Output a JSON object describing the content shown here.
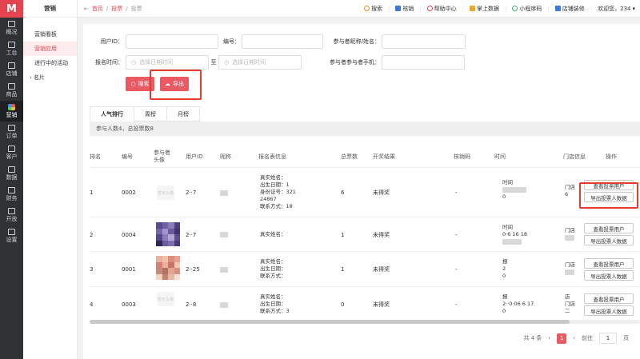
{
  "logo": "M",
  "left_nav": [
    {
      "label": "概况"
    },
    {
      "label": "工台"
    },
    {
      "label": "店铺"
    },
    {
      "label": "商品"
    },
    {
      "label": "营销"
    },
    {
      "label": "订单"
    },
    {
      "label": "客户"
    },
    {
      "label": "数据"
    },
    {
      "label": "财务"
    },
    {
      "label": "开放"
    },
    {
      "label": "设置"
    }
  ],
  "sub_nav": {
    "title": "营销",
    "items": [
      "营销看板",
      "营销应用",
      "进行中的活动"
    ],
    "group": "名片"
  },
  "breadcrumb": {
    "home": "首页",
    "level1": "投票",
    "current": "投票"
  },
  "toolbar": {
    "search": "搜索",
    "verify": "核销",
    "help": "帮助中心",
    "palm_data": "掌上数据",
    "mini_code": "小程序码",
    "decorate": "店铺装修",
    "welcome": "欢迎您，234"
  },
  "filters": {
    "user_id_label": "用户ID：",
    "number_label": "编号：",
    "participant_label": "参与者昵称/姓名：",
    "signup_time_label": "报名时间：",
    "start_placeholder": "选择日期时间",
    "to": "至",
    "end_placeholder": "选择日期时间",
    "phone_label": "参与者参与者手机："
  },
  "buttons": {
    "search": "搜索",
    "export": "导出"
  },
  "tabs": [
    "人气排行",
    "周榜",
    "月榜"
  ],
  "summary": "参与人数4，总投票数8",
  "table": {
    "headers": [
      "排名",
      "编号",
      "参与者头像",
      "用户ID",
      "昵称",
      "报名表信息",
      "总票数",
      "开奖结果",
      "核销码",
      "时间",
      "门店信息",
      "操作"
    ],
    "rows": [
      {
        "rank": "1",
        "number": "0002",
        "avatar_text": "暂无头像",
        "user_id": "2··7",
        "info": [
          "真实姓名：",
          "出生日期：1",
          "身份证号：321",
          "24867",
          "联系方式：18"
        ],
        "votes": "6",
        "result": "未得奖",
        "code": "-",
        "time": [
          "时间",
          "0"
        ],
        "store": [
          "门店",
          "6"
        ],
        "ops": [
          "查看投票用户",
          "导出投票人数据"
        ]
      },
      {
        "rank": "2",
        "number": "0004",
        "avatar_text": "",
        "user_id": "2··7",
        "info": [
          "真实姓名："
        ],
        "votes": "1",
        "result": "未得奖",
        "code": "-",
        "time": [
          "时间",
          "0·6  16 18"
        ],
        "store": [
          "门店",
          ""
        ],
        "ops": [
          "查看投票用户",
          "导出投票人数据"
        ]
      },
      {
        "rank": "3",
        "number": "0001",
        "avatar_text": "",
        "user_id": "2··25",
        "info": [
          "真实姓名：",
          "出生日期：",
          "联系方式："
        ],
        "votes": "1",
        "result": "未得奖",
        "code": "-",
        "time": [
          "报",
          "2",
          "0"
        ],
        "store": [
          "门店",
          ""
        ],
        "ops": [
          "查看投票用户",
          "导出投票人数据"
        ]
      },
      {
        "rank": "4",
        "number": "0003",
        "avatar_text": "暂无头像",
        "user_id": "2··8",
        "info": [
          "真实姓名：",
          "出生日期：",
          "联系方式：3"
        ],
        "votes": "0",
        "result": "未得奖",
        "code": "-",
        "time": [
          "报",
          "2··0·06  6 17",
          "0"
        ],
        "store": [
          "店",
          "门店",
          "二"
        ],
        "ops": [
          "查看投票用户",
          "导出投票人数据"
        ]
      }
    ]
  },
  "pagination": {
    "total": "共 4 条",
    "prev": "‹",
    "current": "1",
    "next": "›",
    "goto": "前往",
    "page_value": "1",
    "unit": "页"
  }
}
